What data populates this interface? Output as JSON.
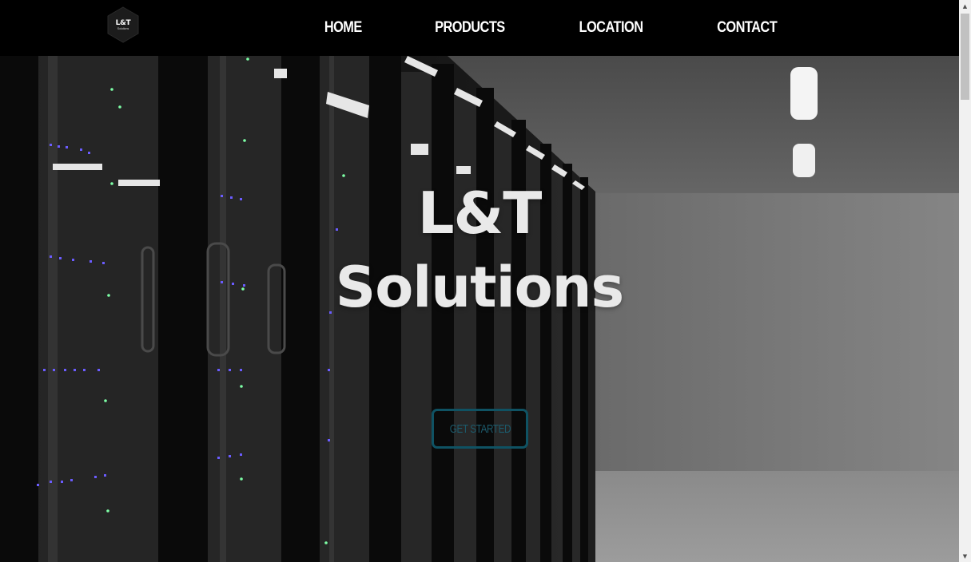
{
  "logo": {
    "main": "L&T",
    "sub": "Solutions"
  },
  "nav": {
    "items": [
      {
        "label": "HOME"
      },
      {
        "label": "PRODUCTS"
      },
      {
        "label": "LOCATION"
      },
      {
        "label": "CONTACT"
      }
    ]
  },
  "hero": {
    "title_line1": "L&T",
    "title_line2": "Solutions",
    "cta_label": "GET STARTED"
  },
  "colors": {
    "navbar_bg": "#000000",
    "nav_text": "#ffffff",
    "cta_border": "#0f5263",
    "cta_text": "#1c5a6b"
  },
  "icons": {
    "scroll_up": "scroll-up-arrow-icon",
    "scroll_down": "scroll-down-arrow-icon"
  },
  "scrollbar": {
    "arrow_up": "▲",
    "arrow_down": "▼"
  }
}
